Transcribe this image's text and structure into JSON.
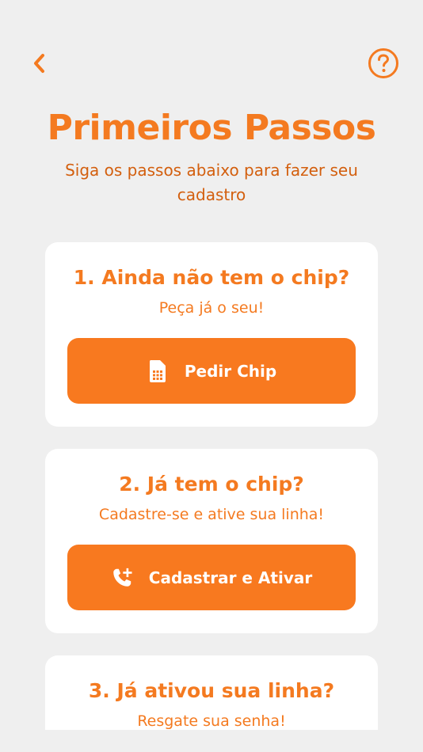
{
  "header": {
    "back_icon": "chevron-left-icon",
    "help_icon": "question-circle-icon"
  },
  "page": {
    "title": "Primeiros Passos",
    "subtitle": "Siga os passos abaixo para fazer seu cadastro"
  },
  "steps": [
    {
      "title": "1. Ainda não tem o chip?",
      "subtitle": "Peça já o seu!",
      "button_label": "Pedir Chip",
      "button_icon": "sim-card-icon"
    },
    {
      "title": "2. Já tem o chip?",
      "subtitle": "Cadastre-se e ative sua linha!",
      "button_label": "Cadastrar e Ativar",
      "button_icon": "phone-add-icon"
    },
    {
      "title": "3. Já ativou sua linha?",
      "subtitle": "Resgate sua senha!"
    }
  ],
  "colors": {
    "accent": "#f47a20",
    "button": "#f8791f",
    "subtitle_text": "#d35f0e",
    "background": "#efefef",
    "card": "#ffffff"
  }
}
